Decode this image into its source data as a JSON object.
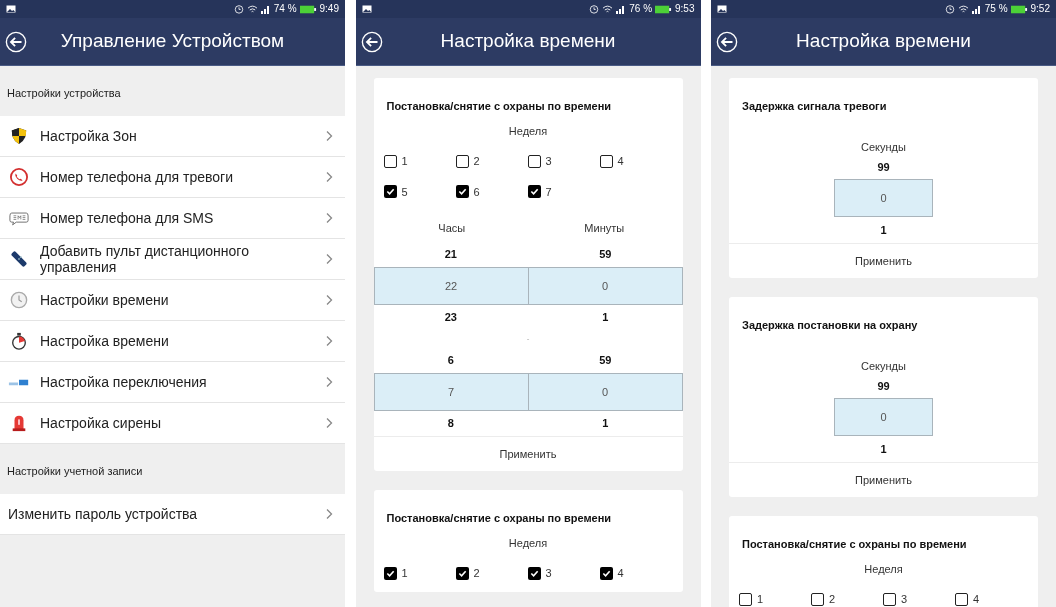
{
  "phones": [
    {
      "status": {
        "battery": "74 %",
        "time": "9:49"
      },
      "title": "Управление Устройством",
      "kind": "menu",
      "sections": [
        {
          "header": "Настройки устройства",
          "items": [
            {
              "label": "Настройка Зон"
            },
            {
              "label": "Номер телефона для тревоги"
            },
            {
              "label": "Номер телефона для SMS"
            },
            {
              "label": "Добавить пульт дистанционного управления"
            },
            {
              "label": "Настройки времени"
            },
            {
              "label": "Настройка времени"
            },
            {
              "label": "Настройка переключения"
            },
            {
              "label": "Настройка сирены"
            }
          ]
        },
        {
          "header": "Настройки учетной записи",
          "items": [
            {
              "label": "Изменить пароль устройства"
            }
          ]
        }
      ]
    },
    {
      "status": {
        "battery": "76 %",
        "time": "9:53"
      },
      "title": "Настройка времени",
      "kind": "cards",
      "cards": [
        {
          "kind": "schedule",
          "title": "Постановка/снятие с охраны по времени",
          "week_label": "Неделя",
          "days": [
            {
              "label": "1",
              "checked": false
            },
            {
              "label": "2",
              "checked": false
            },
            {
              "label": "3",
              "checked": false
            },
            {
              "label": "4",
              "checked": false
            },
            {
              "label": "5",
              "checked": true
            },
            {
              "label": "6",
              "checked": true
            },
            {
              "label": "7",
              "checked": true
            }
          ],
          "columns": [
            "Часы",
            "Минуты"
          ],
          "wheels": [
            {
              "above": [
                "21",
                "59"
              ],
              "selected": [
                "22",
                "0"
              ],
              "below": [
                "23",
                "1"
              ]
            },
            {
              "above": [
                "6",
                "59"
              ],
              "selected": [
                "7",
                "0"
              ],
              "below": [
                "8",
                "1"
              ]
            }
          ],
          "separator": "-",
          "apply": "Применить"
        },
        {
          "kind": "schedule",
          "title": "Постановка/снятие с охраны по времени",
          "week_label": "Неделя",
          "days": [
            {
              "label": "1",
              "checked": true
            },
            {
              "label": "2",
              "checked": true
            },
            {
              "label": "3",
              "checked": true
            },
            {
              "label": "4",
              "checked": true
            }
          ]
        }
      ]
    },
    {
      "status": {
        "battery": "75 %",
        "time": "9:52"
      },
      "title": "Настройка времени",
      "kind": "cards",
      "cards": [
        {
          "kind": "delay",
          "title": "Задержка сигнала тревоги",
          "unit": "Секунды",
          "above": "99",
          "selected": "0",
          "below": "1",
          "apply": "Применить"
        },
        {
          "kind": "delay",
          "title": "Задержка постановки на охрану",
          "unit": "Секунды",
          "above": "99",
          "selected": "0",
          "below": "1",
          "apply": "Применить"
        },
        {
          "kind": "schedule",
          "title": "Постановка/снятие с охраны по времени",
          "week_label": "Неделя",
          "days": [
            {
              "label": "1",
              "checked": false
            },
            {
              "label": "2",
              "checked": false
            },
            {
              "label": "3",
              "checked": false
            },
            {
              "label": "4",
              "checked": false
            }
          ]
        }
      ]
    }
  ]
}
